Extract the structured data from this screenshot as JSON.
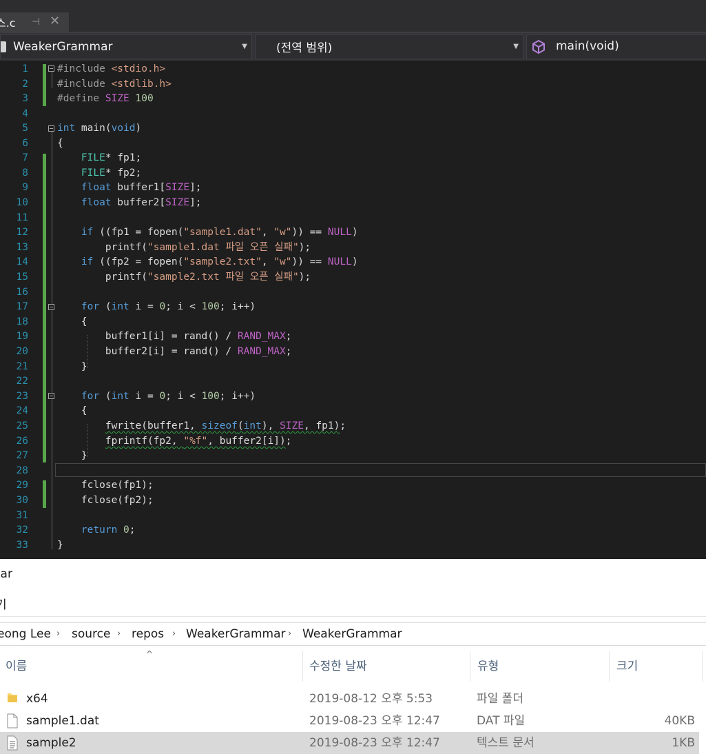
{
  "editor": {
    "tab": {
      "filename": "스.c",
      "pin": "⊣",
      "close": "✕"
    },
    "nav": {
      "project": "WeakerGrammar",
      "scope": "(전역 범위)",
      "member": "main(void)",
      "dropdown_glyph": "▼"
    },
    "line_numbers": [
      "1",
      "2",
      "3",
      "4",
      "5",
      "6",
      "7",
      "8",
      "9",
      "10",
      "11",
      "12",
      "13",
      "14",
      "15",
      "16",
      "17",
      "18",
      "19",
      "20",
      "21",
      "22",
      "23",
      "24",
      "25",
      "26",
      "27",
      "28",
      "29",
      "30",
      "31",
      "32",
      "33"
    ],
    "code": {
      "l1_a": "#include ",
      "l1_b": "<stdio.h>",
      "l2_a": "#include ",
      "l2_b": "<stdlib.h>",
      "l3_a": "#define ",
      "l3_b": "SIZE",
      "l3_c": " 100",
      "l5_a": "int",
      "l5_b": " main(",
      "l5_c": "void",
      "l5_d": ")",
      "l6": "{",
      "l7_a": "    ",
      "l7_b": "FILE",
      "l7_c": "* fp1;",
      "l8_a": "    ",
      "l8_b": "FILE",
      "l8_c": "* fp2;",
      "l9_a": "    ",
      "l9_b": "float",
      "l9_c": " buffer1[",
      "l9_d": "SIZE",
      "l9_e": "];",
      "l10_a": "    ",
      "l10_b": "float",
      "l10_c": " buffer2[",
      "l10_d": "SIZE",
      "l10_e": "];",
      "l12_a": "    ",
      "l12_b": "if",
      "l12_c": " ((fp1 = fopen(",
      "l12_d": "\"sample1.dat\"",
      "l12_e": ", ",
      "l12_f": "\"w\"",
      "l12_g": ")) == ",
      "l12_h": "NULL",
      "l12_i": ")",
      "l13_a": "        printf(",
      "l13_b": "\"sample1.dat 파일 오픈 실패\"",
      "l13_c": ");",
      "l14_a": "    ",
      "l14_b": "if",
      "l14_c": " ((fp2 = fopen(",
      "l14_d": "\"sample2.txt\"",
      "l14_e": ", ",
      "l14_f": "\"w\"",
      "l14_g": ")) == ",
      "l14_h": "NULL",
      "l14_i": ")",
      "l15_a": "        printf(",
      "l15_b": "\"sample2.txt 파일 오픈 실패\"",
      "l15_c": ");",
      "l17_a": "    ",
      "l17_b": "for",
      "l17_c": " (",
      "l17_d": "int",
      "l17_e": " i = ",
      "l17_f": "0",
      "l17_g": "; i < ",
      "l17_h": "100",
      "l17_i": "; i++)",
      "l18": "    {",
      "l19_a": "        buffer1[i] = rand() / ",
      "l19_b": "RAND_MAX",
      "l19_c": ";",
      "l20_a": "        buffer2[i] = rand() / ",
      "l20_b": "RAND_MAX",
      "l20_c": ";",
      "l21": "    }",
      "l23_a": "    ",
      "l23_b": "for",
      "l23_c": " (",
      "l23_d": "int",
      "l23_e": " i = ",
      "l23_f": "0",
      "l23_g": "; i < ",
      "l23_h": "100",
      "l23_i": "; i++)",
      "l24": "    {",
      "l25_a": "        ",
      "l25_b": "fwrite(buffer1, ",
      "l25_c": "sizeof",
      "l25_d": "(",
      "l25_e": "int",
      "l25_f": "), ",
      "l25_g": "SIZE",
      "l25_h": ", fp1)",
      "l25_i": ";",
      "l26_a": "        ",
      "l26_b": "fprintf(fp2, ",
      "l26_c": "\"%f\"",
      "l26_d": ", buffer2[i])",
      "l26_e": ";",
      "l27": "    }",
      "l29": "    fclose(fp1);",
      "l30": "    fclose(fp2);",
      "l32_a": "    ",
      "l32_b": "return",
      "l32_c": " ",
      "l32_d": "0",
      "l32_e": ";",
      "l33": "}"
    },
    "colors": {
      "keyword": "#569cd6",
      "string": "#d69d85",
      "number": "#b5cea8",
      "macro": "#bd63c5",
      "type": "#4ec9b0",
      "line_number": "#2b91af",
      "change_bar": "#57a64a"
    }
  },
  "explorer": {
    "window_title": "mar",
    "ribbon_label": "기",
    "breadcrumbs": [
      "eong Lee",
      "source",
      "repos",
      "WeakerGrammar",
      "WeakerGrammar"
    ],
    "breadcrumb_separator": "›",
    "sort_indicator": "^",
    "columns": {
      "name": "이름",
      "date": "수정한 날짜",
      "type": "유형",
      "size": "크기"
    },
    "files": [
      {
        "name": "x64",
        "date": "2019-08-12 오후 5:53",
        "type": "파일 폴더",
        "size": "",
        "icon": "folder-icon"
      },
      {
        "name": "sample1.dat",
        "date": "2019-08-23 오후 12:47",
        "type": "DAT 파일",
        "size": "40KB",
        "icon": "file-icon"
      },
      {
        "name": "sample2",
        "date": "2019-08-23 오후 12:47",
        "type": "텍스트 문서",
        "size": "1KB",
        "icon": "text-file-icon",
        "selected": true
      }
    ]
  }
}
